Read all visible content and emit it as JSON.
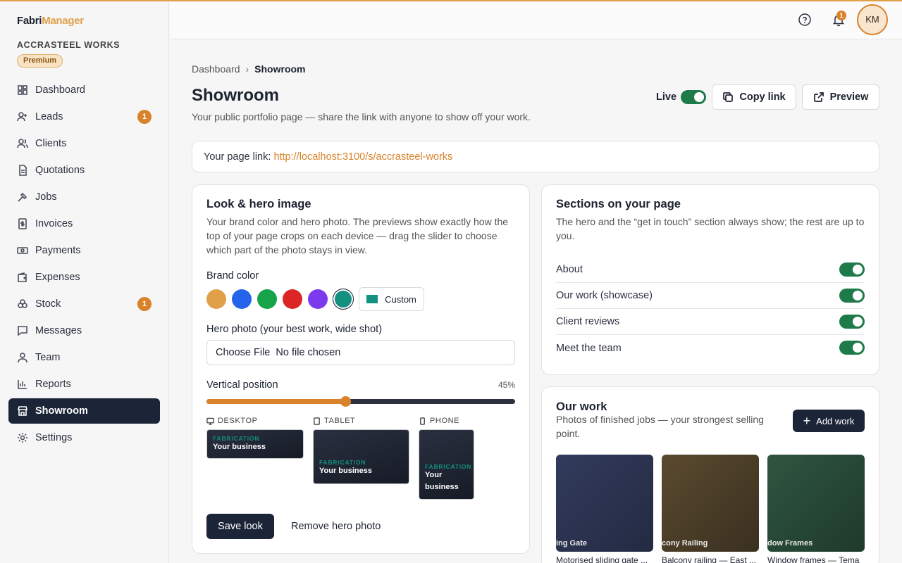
{
  "brand": {
    "part1": "Fabri",
    "part2": "Manager"
  },
  "company": {
    "name": "ACCRASTEEL WORKS",
    "plan": "Premium"
  },
  "sidebar": {
    "items": [
      {
        "label": "Dashboard",
        "icon": "dashboard-icon",
        "badge": null
      },
      {
        "label": "Leads",
        "icon": "user-plus-icon",
        "badge": "1"
      },
      {
        "label": "Clients",
        "icon": "users-icon",
        "badge": null
      },
      {
        "label": "Quotations",
        "icon": "document-icon",
        "badge": null
      },
      {
        "label": "Jobs",
        "icon": "hammer-icon",
        "badge": null
      },
      {
        "label": "Invoices",
        "icon": "invoice-icon",
        "badge": null
      },
      {
        "label": "Payments",
        "icon": "banknote-icon",
        "badge": null
      },
      {
        "label": "Expenses",
        "icon": "wallet-icon",
        "badge": null
      },
      {
        "label": "Stock",
        "icon": "boxes-icon",
        "badge": "1"
      },
      {
        "label": "Messages",
        "icon": "message-icon",
        "badge": null
      },
      {
        "label": "Team",
        "icon": "user-icon",
        "badge": null
      },
      {
        "label": "Reports",
        "icon": "bar-chart-icon",
        "badge": null
      },
      {
        "label": "Showroom",
        "icon": "store-icon",
        "badge": null,
        "active": true
      },
      {
        "label": "Settings",
        "icon": "gear-icon",
        "badge": null
      }
    ]
  },
  "topbar": {
    "notifications_count": "1",
    "avatar_initials": "KM"
  },
  "breadcrumb": {
    "parent": "Dashboard",
    "current": "Showroom"
  },
  "page": {
    "title": "Showroom",
    "subtitle": "Your public portfolio page — share the link with anyone to show off your work.",
    "live_label": "Live",
    "live_on": true,
    "copy_link_label": "Copy link",
    "preview_label": "Preview"
  },
  "link_box": {
    "label": "Your page link:",
    "url": "http://localhost:3100/s/accrasteel-works"
  },
  "look_card": {
    "title": "Look & hero image",
    "description": "Your brand color and hero photo. The previews show exactly how the top of your page crops on each device — drag the slider to choose which part of the photo stays in view.",
    "brand_color_label": "Brand color",
    "swatches": [
      "#e0a04a",
      "#2563eb",
      "#16a34a",
      "#dc2626",
      "#7c3aed",
      "#13907f"
    ],
    "selected_swatch": "#13907f",
    "custom_label": "Custom",
    "hero_label": "Hero photo (your best work, wide shot)",
    "file_button": "Choose File",
    "file_status": "No file chosen",
    "vertical_label": "Vertical position",
    "vertical_value_text": "45%",
    "vertical_value": 0.45,
    "devices": [
      {
        "label": "DESKTOP",
        "icon": "monitor-icon"
      },
      {
        "label": "TABLET",
        "icon": "tablet-icon"
      },
      {
        "label": "PHONE",
        "icon": "phone-icon"
      }
    ],
    "preview_kicker": "FABRICATION",
    "preview_name": "Your business",
    "save_label": "Save look",
    "remove_label": "Remove hero photo"
  },
  "sections_card": {
    "title": "Sections on your page",
    "description": "The hero and the “get in touch” section always show; the rest are up to you.",
    "rows": [
      {
        "label": "About",
        "on": true
      },
      {
        "label": "Our work (showcase)",
        "on": true
      },
      {
        "label": "Client reviews",
        "on": true
      },
      {
        "label": "Meet the team",
        "on": true
      }
    ]
  },
  "work_card": {
    "title": "Our work",
    "description": "Photos of finished jobs — your strongest selling point.",
    "add_label": "Add work",
    "items": [
      {
        "caption": "ing Gate",
        "title": "Motorised sliding gate ...",
        "color": "#2b3350"
      },
      {
        "caption": "cony Railing",
        "title": "Balcony railing — East ...",
        "color": "#4e4128"
      },
      {
        "caption": "dow Frames",
        "title": "Window frames — Tema",
        "color": "#2a4a3a"
      }
    ]
  },
  "colors": {
    "accent": "#d9822b",
    "dark": "#1c2438",
    "toggle_on": "#1f7a4a"
  }
}
